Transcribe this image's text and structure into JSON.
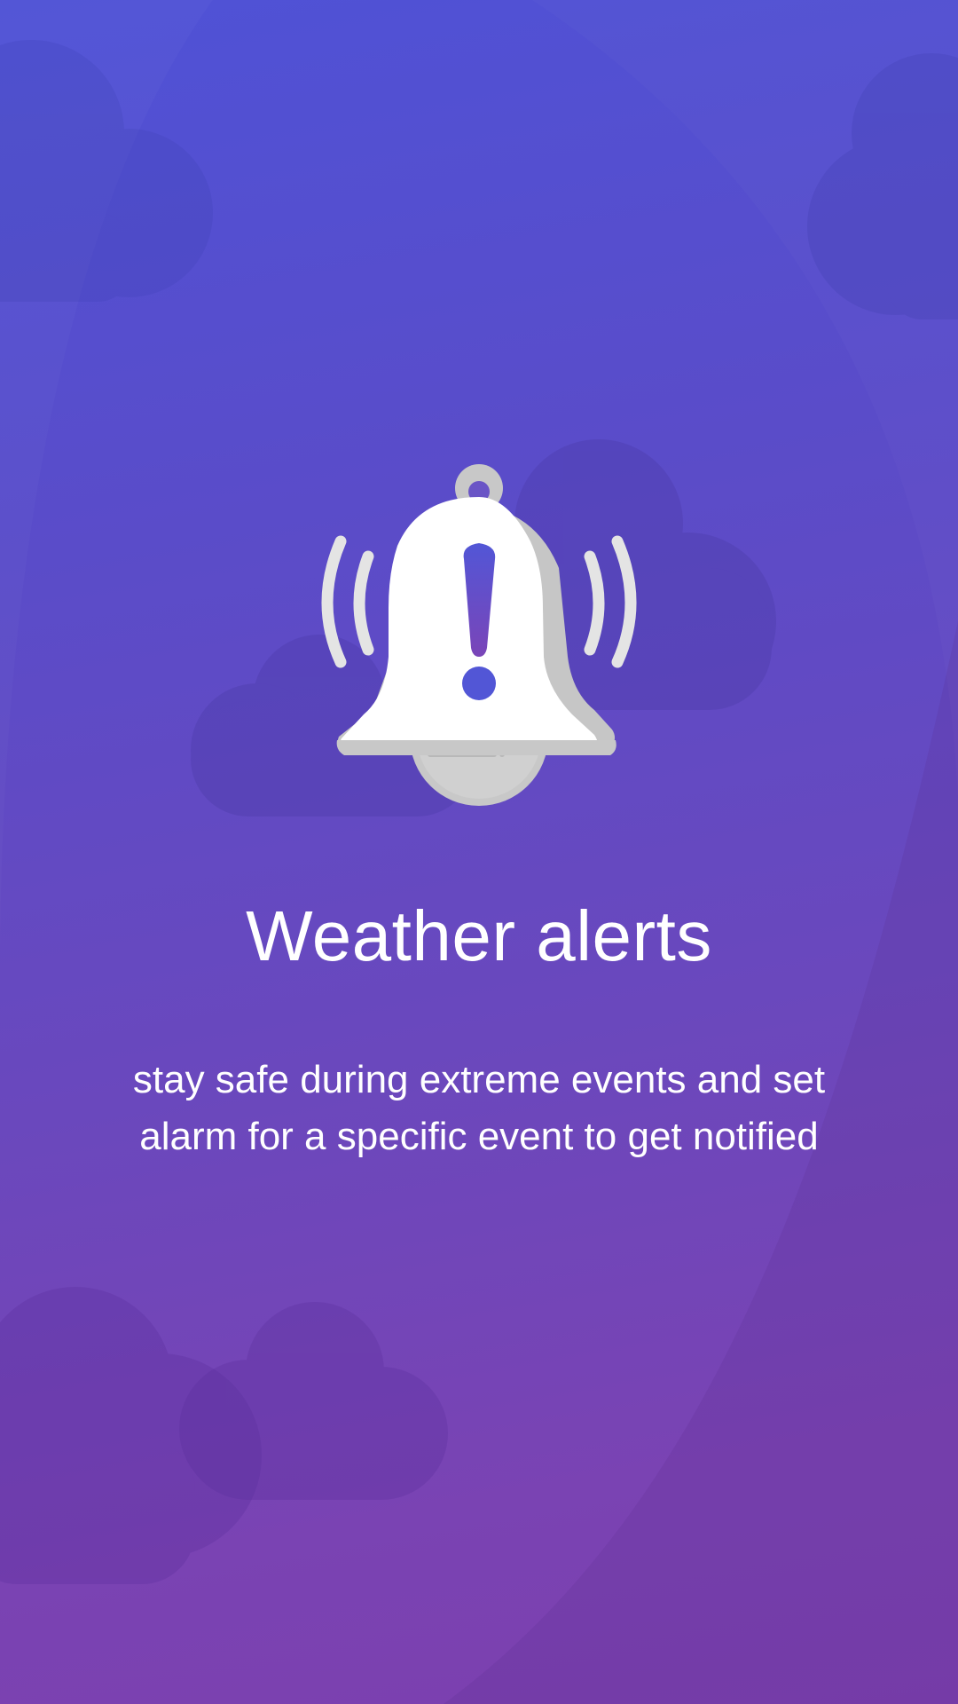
{
  "onboarding": {
    "title": "Weather alerts",
    "description_line1": "stay safe during extreme events and set",
    "description_line2": "alarm for a specific event to get notified",
    "illustration_icon": "ringing-bell-alert-icon",
    "background_icons": [
      "cloud-icon",
      "cloud-icon",
      "cloud-icon",
      "cloud-icon",
      "cloud-icon"
    ]
  },
  "colors": {
    "gradient_top": "#4f52d6",
    "gradient_bottom": "#7c3fae",
    "bell_body": "#ffffff",
    "bell_shadow": "#c8c8c8",
    "alert_mark_top": "#5256d6",
    "alert_mark_bottom": "#7a45b8",
    "text": "#ffffff"
  }
}
